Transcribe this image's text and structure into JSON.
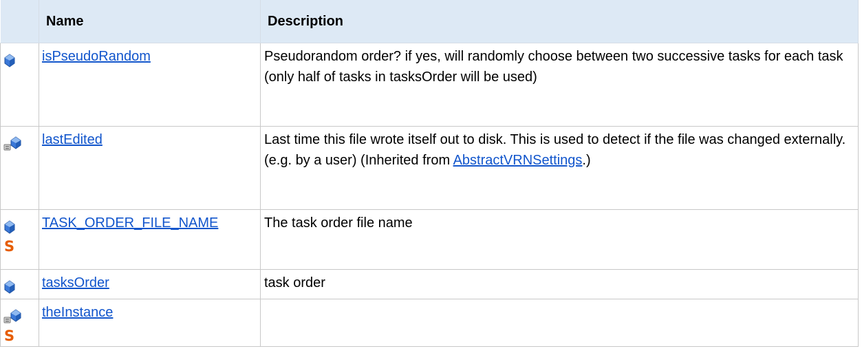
{
  "table": {
    "header": {
      "icon": "",
      "name": "Name",
      "description": "Description"
    },
    "rows": [
      {
        "icons": [
          "public-field-icon"
        ],
        "static": false,
        "name": "isPseudoRandom",
        "description": "Pseudorandom order? if yes, will randomly choose between two successive tasks for each task (only half of tasks in tasksOrder will be used)"
      },
      {
        "icons": [
          "protected-field-icon"
        ],
        "static": false,
        "name": "lastEdited",
        "description_prefix": "Last time this file wrote itself out to disk. This is used to detect if the file was changed externally. (e.g. by a user) (Inherited from ",
        "description_link": "AbstractVRNSettings",
        "description_suffix": ".)"
      },
      {
        "icons": [
          "public-field-icon",
          "static-icon"
        ],
        "static": true,
        "static_symbol": "S",
        "name": "TASK_ORDER_FILE_NAME",
        "description": "The task order file name"
      },
      {
        "icons": [
          "public-field-icon"
        ],
        "static": false,
        "name": "tasksOrder",
        "description": "task order"
      },
      {
        "icons": [
          "protected-field-icon",
          "static-icon"
        ],
        "static": true,
        "static_symbol": "S",
        "name": "theInstance",
        "description": ""
      }
    ]
  },
  "colors": {
    "header_bg": "#dde9f5",
    "link": "#1155cc",
    "field_icon_blue": "#3a78d8",
    "static_orange": "#e65c00",
    "border": "#c8c8c8"
  }
}
